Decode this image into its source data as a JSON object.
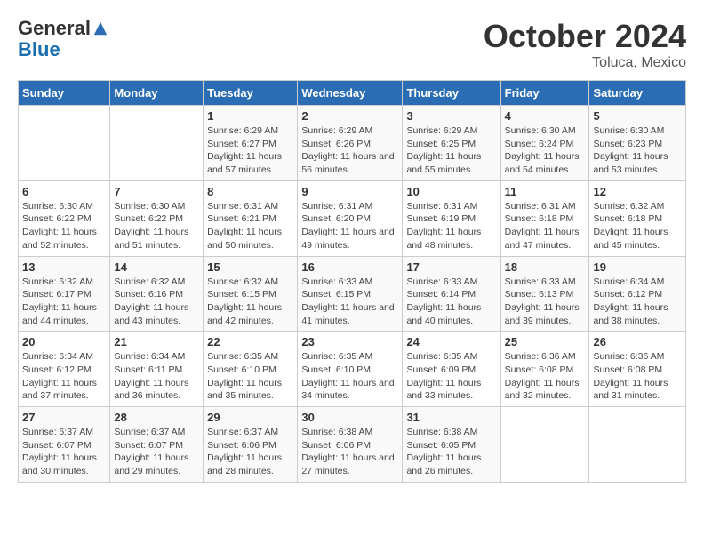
{
  "header": {
    "logo_line1": "General",
    "logo_line2": "Blue",
    "month": "October 2024",
    "location": "Toluca, Mexico"
  },
  "weekdays": [
    "Sunday",
    "Monday",
    "Tuesday",
    "Wednesday",
    "Thursday",
    "Friday",
    "Saturday"
  ],
  "weeks": [
    [
      {
        "day": "",
        "sunrise": "",
        "sunset": "",
        "daylight": ""
      },
      {
        "day": "",
        "sunrise": "",
        "sunset": "",
        "daylight": ""
      },
      {
        "day": "1",
        "sunrise": "Sunrise: 6:29 AM",
        "sunset": "Sunset: 6:27 PM",
        "daylight": "Daylight: 11 hours and 57 minutes."
      },
      {
        "day": "2",
        "sunrise": "Sunrise: 6:29 AM",
        "sunset": "Sunset: 6:26 PM",
        "daylight": "Daylight: 11 hours and 56 minutes."
      },
      {
        "day": "3",
        "sunrise": "Sunrise: 6:29 AM",
        "sunset": "Sunset: 6:25 PM",
        "daylight": "Daylight: 11 hours and 55 minutes."
      },
      {
        "day": "4",
        "sunrise": "Sunrise: 6:30 AM",
        "sunset": "Sunset: 6:24 PM",
        "daylight": "Daylight: 11 hours and 54 minutes."
      },
      {
        "day": "5",
        "sunrise": "Sunrise: 6:30 AM",
        "sunset": "Sunset: 6:23 PM",
        "daylight": "Daylight: 11 hours and 53 minutes."
      }
    ],
    [
      {
        "day": "6",
        "sunrise": "Sunrise: 6:30 AM",
        "sunset": "Sunset: 6:22 PM",
        "daylight": "Daylight: 11 hours and 52 minutes."
      },
      {
        "day": "7",
        "sunrise": "Sunrise: 6:30 AM",
        "sunset": "Sunset: 6:22 PM",
        "daylight": "Daylight: 11 hours and 51 minutes."
      },
      {
        "day": "8",
        "sunrise": "Sunrise: 6:31 AM",
        "sunset": "Sunset: 6:21 PM",
        "daylight": "Daylight: 11 hours and 50 minutes."
      },
      {
        "day": "9",
        "sunrise": "Sunrise: 6:31 AM",
        "sunset": "Sunset: 6:20 PM",
        "daylight": "Daylight: 11 hours and 49 minutes."
      },
      {
        "day": "10",
        "sunrise": "Sunrise: 6:31 AM",
        "sunset": "Sunset: 6:19 PM",
        "daylight": "Daylight: 11 hours and 48 minutes."
      },
      {
        "day": "11",
        "sunrise": "Sunrise: 6:31 AM",
        "sunset": "Sunset: 6:18 PM",
        "daylight": "Daylight: 11 hours and 47 minutes."
      },
      {
        "day": "12",
        "sunrise": "Sunrise: 6:32 AM",
        "sunset": "Sunset: 6:18 PM",
        "daylight": "Daylight: 11 hours and 45 minutes."
      }
    ],
    [
      {
        "day": "13",
        "sunrise": "Sunrise: 6:32 AM",
        "sunset": "Sunset: 6:17 PM",
        "daylight": "Daylight: 11 hours and 44 minutes."
      },
      {
        "day": "14",
        "sunrise": "Sunrise: 6:32 AM",
        "sunset": "Sunset: 6:16 PM",
        "daylight": "Daylight: 11 hours and 43 minutes."
      },
      {
        "day": "15",
        "sunrise": "Sunrise: 6:32 AM",
        "sunset": "Sunset: 6:15 PM",
        "daylight": "Daylight: 11 hours and 42 minutes."
      },
      {
        "day": "16",
        "sunrise": "Sunrise: 6:33 AM",
        "sunset": "Sunset: 6:15 PM",
        "daylight": "Daylight: 11 hours and 41 minutes."
      },
      {
        "day": "17",
        "sunrise": "Sunrise: 6:33 AM",
        "sunset": "Sunset: 6:14 PM",
        "daylight": "Daylight: 11 hours and 40 minutes."
      },
      {
        "day": "18",
        "sunrise": "Sunrise: 6:33 AM",
        "sunset": "Sunset: 6:13 PM",
        "daylight": "Daylight: 11 hours and 39 minutes."
      },
      {
        "day": "19",
        "sunrise": "Sunrise: 6:34 AM",
        "sunset": "Sunset: 6:12 PM",
        "daylight": "Daylight: 11 hours and 38 minutes."
      }
    ],
    [
      {
        "day": "20",
        "sunrise": "Sunrise: 6:34 AM",
        "sunset": "Sunset: 6:12 PM",
        "daylight": "Daylight: 11 hours and 37 minutes."
      },
      {
        "day": "21",
        "sunrise": "Sunrise: 6:34 AM",
        "sunset": "Sunset: 6:11 PM",
        "daylight": "Daylight: 11 hours and 36 minutes."
      },
      {
        "day": "22",
        "sunrise": "Sunrise: 6:35 AM",
        "sunset": "Sunset: 6:10 PM",
        "daylight": "Daylight: 11 hours and 35 minutes."
      },
      {
        "day": "23",
        "sunrise": "Sunrise: 6:35 AM",
        "sunset": "Sunset: 6:10 PM",
        "daylight": "Daylight: 11 hours and 34 minutes."
      },
      {
        "day": "24",
        "sunrise": "Sunrise: 6:35 AM",
        "sunset": "Sunset: 6:09 PM",
        "daylight": "Daylight: 11 hours and 33 minutes."
      },
      {
        "day": "25",
        "sunrise": "Sunrise: 6:36 AM",
        "sunset": "Sunset: 6:08 PM",
        "daylight": "Daylight: 11 hours and 32 minutes."
      },
      {
        "day": "26",
        "sunrise": "Sunrise: 6:36 AM",
        "sunset": "Sunset: 6:08 PM",
        "daylight": "Daylight: 11 hours and 31 minutes."
      }
    ],
    [
      {
        "day": "27",
        "sunrise": "Sunrise: 6:37 AM",
        "sunset": "Sunset: 6:07 PM",
        "daylight": "Daylight: 11 hours and 30 minutes."
      },
      {
        "day": "28",
        "sunrise": "Sunrise: 6:37 AM",
        "sunset": "Sunset: 6:07 PM",
        "daylight": "Daylight: 11 hours and 29 minutes."
      },
      {
        "day": "29",
        "sunrise": "Sunrise: 6:37 AM",
        "sunset": "Sunset: 6:06 PM",
        "daylight": "Daylight: 11 hours and 28 minutes."
      },
      {
        "day": "30",
        "sunrise": "Sunrise: 6:38 AM",
        "sunset": "Sunset: 6:06 PM",
        "daylight": "Daylight: 11 hours and 27 minutes."
      },
      {
        "day": "31",
        "sunrise": "Sunrise: 6:38 AM",
        "sunset": "Sunset: 6:05 PM",
        "daylight": "Daylight: 11 hours and 26 minutes."
      },
      {
        "day": "",
        "sunrise": "",
        "sunset": "",
        "daylight": ""
      },
      {
        "day": "",
        "sunrise": "",
        "sunset": "",
        "daylight": ""
      }
    ]
  ]
}
